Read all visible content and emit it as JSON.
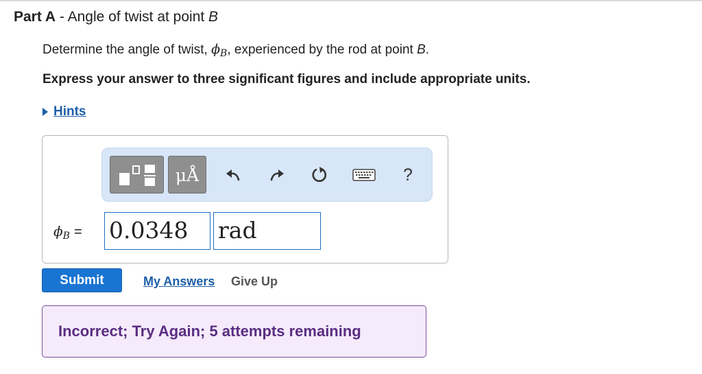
{
  "part": {
    "label": "Part A",
    "separator": " - ",
    "title_prefix": "Angle of twist at point ",
    "title_point": "B"
  },
  "question": {
    "prefix": "Determine the angle of twist, ",
    "symbol": "ϕ",
    "subscript": "B",
    "suffix": ", experienced by the rod at point ",
    "point": "B",
    "end": "."
  },
  "instruction": "Express your answer to three significant figures and include appropriate units.",
  "hints": {
    "label": "Hints"
  },
  "toolbar": {
    "units_label": "μÅ",
    "buttons": [
      "templates-icon",
      "units-icon",
      "undo-icon",
      "redo-icon",
      "reset-icon",
      "keyboard-icon",
      "help-icon"
    ],
    "help_label": "?"
  },
  "answer": {
    "symbol": "ϕ",
    "subscript": "B",
    "equals": "=",
    "value": "0.0348",
    "units": "rad"
  },
  "actions": {
    "submit": "Submit",
    "my_answers": "My Answers",
    "give_up": "Give Up"
  },
  "feedback": {
    "message": "Incorrect; Try Again; 5 attempts remaining"
  },
  "colors": {
    "link": "#1d5fa8",
    "submit": "#1a74d2",
    "feedback_bg": "#f5ebfb",
    "feedback_border": "#7d4c9e",
    "toolbar_bg": "#d7e6f8"
  }
}
